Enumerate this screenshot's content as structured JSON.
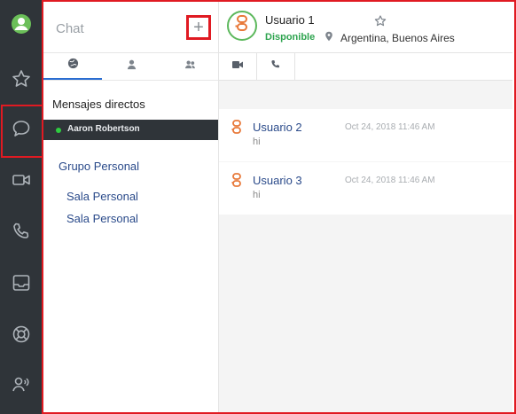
{
  "colors": {
    "rail": "#2f3439",
    "highlight": "#e01a22",
    "online": "#2ecc40",
    "link": "#2a4a8a",
    "status": "#2ea44f"
  },
  "rail": {
    "items": [
      {
        "icon": "user-avatar-icon"
      },
      {
        "icon": "star-icon"
      },
      {
        "icon": "chat-bubble-icon"
      },
      {
        "icon": "video-icon"
      },
      {
        "icon": "phone-icon"
      },
      {
        "icon": "inbox-icon"
      },
      {
        "icon": "support-icon"
      },
      {
        "icon": "contact-speaking-icon"
      }
    ]
  },
  "chat_panel": {
    "title": "Chat",
    "new_chat_symbol": "+",
    "tabs": [
      {
        "icon": "globe-icon"
      },
      {
        "icon": "person-icon"
      },
      {
        "icon": "group-icon"
      }
    ],
    "direct_title": "Mensajes directos",
    "contact": {
      "name": "Aaron Robertson",
      "status": "online"
    },
    "group_title": "Grupo Personal",
    "rooms": [
      "Sala Personal",
      "Sala Personal"
    ]
  },
  "conversation": {
    "user_name": "Usuario 1",
    "status": "Disponible",
    "location": "Argentina, Buenos Aires",
    "tabs": [
      {
        "icon": "video-camera-icon"
      },
      {
        "icon": "phone-icon"
      }
    ],
    "messages": [
      {
        "sender": "Usuario 2",
        "time": "Oct 24, 2018 11:46 AM",
        "text": "hi"
      },
      {
        "sender": "Usuario 3",
        "time": "Oct 24, 2018 11:46 AM",
        "text": "hi"
      }
    ]
  }
}
